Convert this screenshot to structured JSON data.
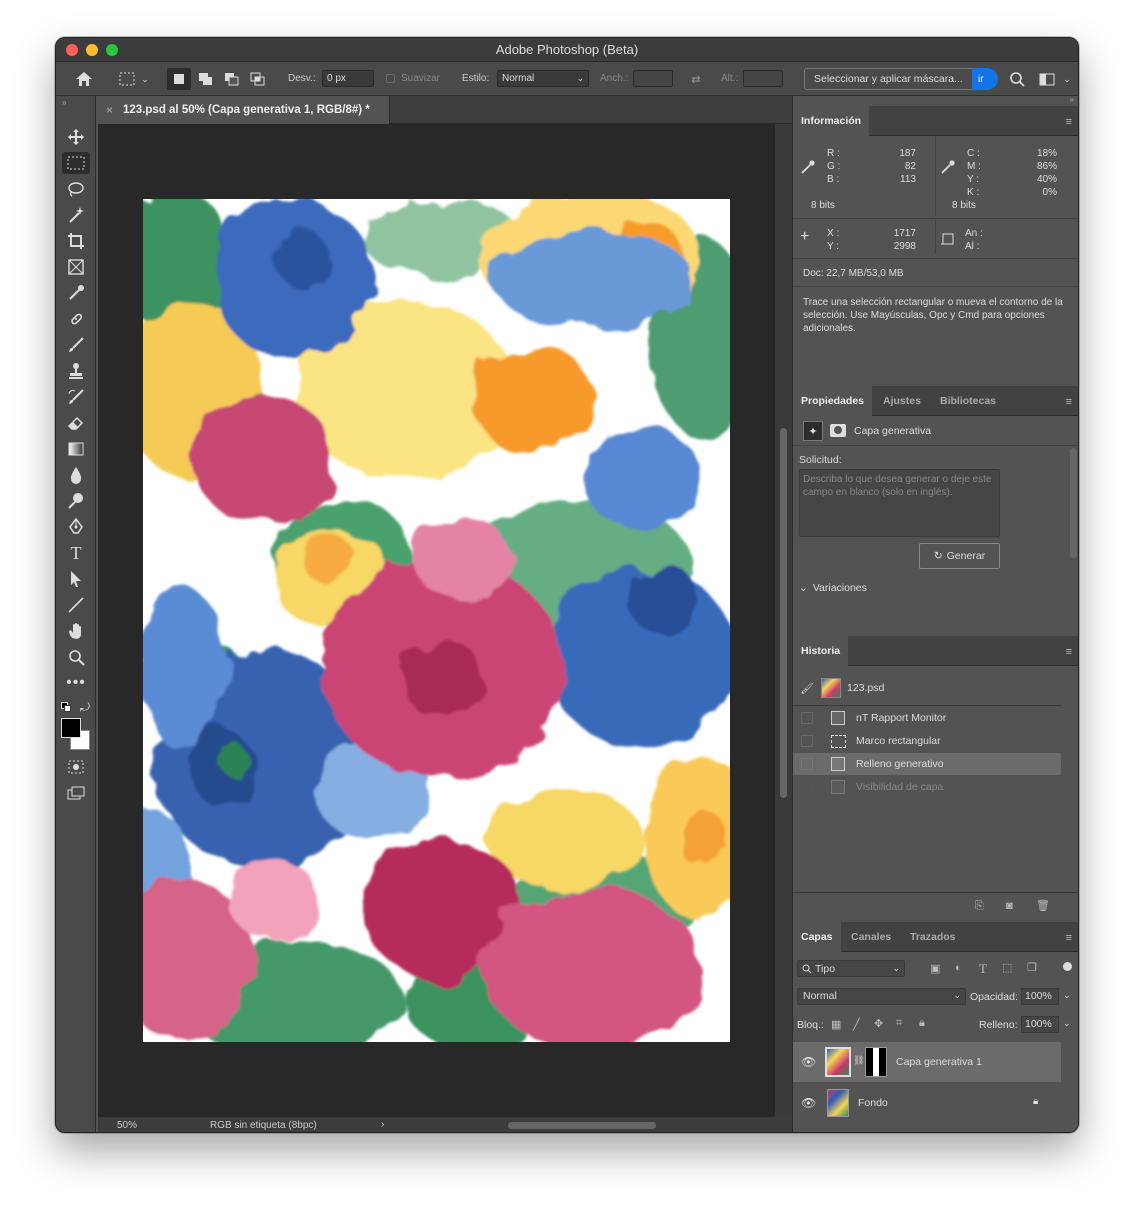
{
  "window": {
    "title": "Adobe Photoshop (Beta)"
  },
  "options": {
    "desv_label": "Desv.:",
    "desv_value": "0 px",
    "suavizar_label": "Suavizar",
    "estilo_label": "Estilo:",
    "estilo_value": "Normal",
    "anch_label": "Anch.:",
    "alt_label": "Alt.:",
    "mask_button": "Seleccionar y aplicar máscara..."
  },
  "document": {
    "tab_title": "123.psd al 50% (Capa generativa 1, RGB/8#) *",
    "zoom": "50%",
    "color_profile": "RGB sin etiqueta (8bpc)"
  },
  "info": {
    "tab": "Información",
    "r_label": "R :",
    "g_label": "G :",
    "b_label": "B :",
    "r": "187",
    "g": "82",
    "b": "113",
    "c_label": "C :",
    "m_label": "M :",
    "y_label": "Y :",
    "k_label": "K :",
    "c": "18%",
    "m": "86%",
    "y": "40%",
    "k": "0%",
    "bits_left": "8 bits",
    "bits_right": "8 bits",
    "x_label": "X :",
    "y_coord_label": "Y :",
    "x": "1717",
    "y_coord": "2998",
    "an_label": "An :",
    "al_label": "Al :",
    "doc": "Doc: 22,7 MB/53,0 MB",
    "hint": "Trace una selección rectangular o mueva el contorno de la selección. Use Mayúsculas, Opc y Cmd para opciones adicionales."
  },
  "properties": {
    "tabs": [
      "Propiedades",
      "Ajustes",
      "Bibliotecas"
    ],
    "layer_type": "Capa generativa",
    "prompt_label": "Solicitud:",
    "prompt_placeholder": "Describa lo que desea generar o deje este campo en blanco (solo en inglés).",
    "generate_button": "Generar",
    "variations": "Variaciones"
  },
  "history": {
    "tab": "Historia",
    "snapshot": "123.psd",
    "items": [
      "nT Rapport Monitor",
      "Marco rectangular",
      "Relleno generativo",
      "Visibilidad de capa"
    ]
  },
  "layers": {
    "tabs": [
      "Capas",
      "Canales",
      "Trazados"
    ],
    "filter": "Tipo",
    "blend_mode": "Normal",
    "opacity_label": "Opacidad:",
    "opacity": "100%",
    "lock_label": "Bloq.:",
    "fill_label": "Relleno:",
    "fill": "100%",
    "items": [
      {
        "name": "Capa generativa 1"
      },
      {
        "name": "Fondo"
      }
    ]
  },
  "colors": {
    "sample_rgb": "#bb5271",
    "foreground": "#000000",
    "background": "#ffffff",
    "accent": "#1473e6"
  }
}
